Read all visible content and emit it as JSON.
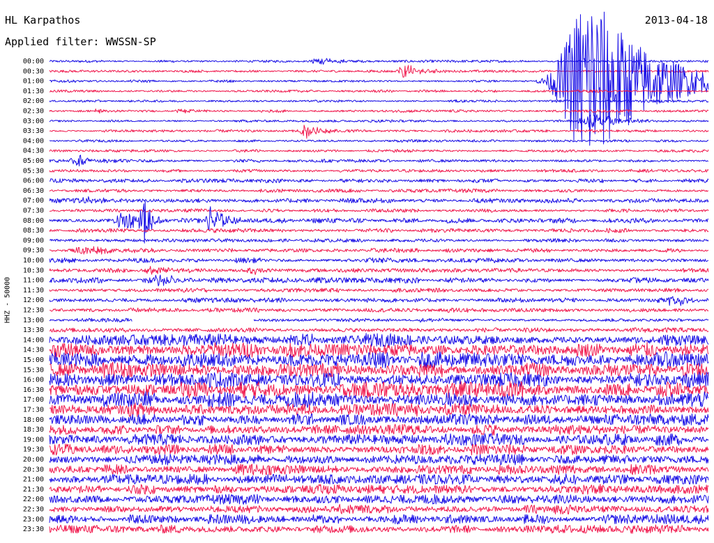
{
  "header": {
    "station": "HL Karpathos",
    "filter": "Applied filter: WWSSN-SP",
    "date": "2013-04-18"
  },
  "channel_label": "HHZ - 50000",
  "colors": {
    "trace_a": "#1a10e6",
    "trace_b": "#f01a4e",
    "text": "#000000",
    "background": "#ffffff"
  },
  "chart_data": {
    "type": "line",
    "title": "HL Karpathos",
    "subtitle": "Applied filter: WWSSN-SP",
    "date": "2013-04-18",
    "ylabel": "HHZ - 50000",
    "xlabel": "",
    "rows": [
      "00:00",
      "00:30",
      "01:00",
      "01:30",
      "02:00",
      "02:30",
      "03:00",
      "03:30",
      "04:00",
      "04:30",
      "05:00",
      "05:30",
      "06:00",
      "06:30",
      "07:00",
      "07:30",
      "08:00",
      "08:30",
      "09:00",
      "09:30",
      "10:00",
      "10:30",
      "11:00",
      "11:30",
      "12:00",
      "12:30",
      "13:00",
      "13:30",
      "14:00",
      "14:30",
      "15:00",
      "15:30",
      "16:00",
      "16:30",
      "17:00",
      "17:30",
      "18:00",
      "18:30",
      "19:00",
      "19:30",
      "20:00",
      "20:30",
      "21:00",
      "21:30",
      "22:00",
      "22:30",
      "23:00",
      "23:30"
    ],
    "row_minutes": 30,
    "series_colors": [
      "#1a10e6",
      "#f01a4e"
    ],
    "noise_level": [
      1.3,
      1.3,
      1.3,
      1.3,
      1.3,
      1.4,
      1.4,
      1.4,
      1.4,
      1.5,
      1.6,
      1.6,
      2.0,
      1.8,
      2.4,
      1.8,
      2.6,
      2.2,
      1.8,
      2.2,
      2.6,
      2.4,
      2.8,
      2.2,
      2.4,
      2.4,
      2.0,
      2.4,
      6.5,
      7.5,
      8.0,
      8.0,
      8.5,
      8.5,
      8.0,
      7.0,
      6.0,
      5.5,
      6.0,
      5.5,
      5.5,
      5.5,
      5.5,
      5.0,
      5.0,
      4.8,
      4.8,
      4.5
    ],
    "events": [
      {
        "row": "00:00",
        "minute": 12.3,
        "amplitude": 6,
        "duration": 0.8
      },
      {
        "row": "00:30",
        "minute": 16.2,
        "amplitude": 9,
        "duration": 0.7
      },
      {
        "row": "02:30",
        "minute": 2.2,
        "amplitude": 3,
        "duration": 0.6
      },
      {
        "row": "02:30",
        "minute": 6.0,
        "amplitude": 3,
        "duration": 0.6
      },
      {
        "row": "03:30",
        "minute": 11.7,
        "amplitude": 10,
        "duration": 0.6
      },
      {
        "row": "05:00",
        "minute": 1.3,
        "amplitude": 8,
        "duration": 0.6
      },
      {
        "row": "07:00",
        "minute": 1.5,
        "amplitude": 4,
        "duration": 1.0
      },
      {
        "row": "08:00",
        "minute": 3.4,
        "amplitude": 14,
        "duration": 0.8
      },
      {
        "row": "08:00",
        "minute": 4.3,
        "amplitude": 40,
        "duration": 0.3
      },
      {
        "row": "08:00",
        "minute": 7.4,
        "amplitude": 24,
        "duration": 0.5
      },
      {
        "row": "09:30",
        "minute": 1.7,
        "amplitude": 6,
        "duration": 1.5
      },
      {
        "row": "10:30",
        "minute": 4.8,
        "amplitude": 6,
        "duration": 1.0
      },
      {
        "row": "10:30",
        "minute": 9.3,
        "amplitude": 5,
        "duration": 0.6
      },
      {
        "row": "11:00",
        "minute": 4.9,
        "amplitude": 6,
        "duration": 1.0
      },
      {
        "row": "12:00",
        "minute": 28.4,
        "amplitude": 8,
        "duration": 0.6
      },
      {
        "row": "01:00",
        "minute": 24.6,
        "amplitude": 130,
        "duration": 2.5
      },
      {
        "row": "03:00",
        "minute": 24.8,
        "amplitude": 12,
        "duration": 1.2
      }
    ],
    "data_gap": {
      "row": "13:00",
      "start_minute": 3.8,
      "end_minute": 9.3
    },
    "grid": false,
    "legend": "none"
  }
}
